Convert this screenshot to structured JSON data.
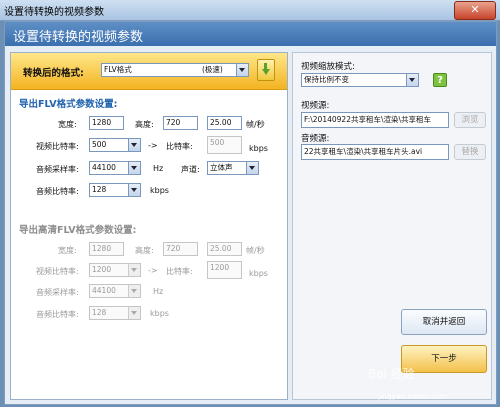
{
  "window": {
    "title": "设置待转换的视频参数"
  },
  "header": {
    "title": "设置待转换的视频参数"
  },
  "format": {
    "label": "转换后的格式:",
    "value": "FLV格式",
    "quality": "(极速)"
  },
  "flv": {
    "section_title": "导出FLV格式参数设置:",
    "width_label": "宽度:",
    "width_value": "1280",
    "height_label": "高度:",
    "height_value": "720",
    "fps_value": "25.00",
    "fps_unit": "帧/秒",
    "vbitrate_label": "视频比特率:",
    "vbitrate_value": "500",
    "arrow": "->",
    "bitrate_label": "比特率:",
    "bitrate_value": "500",
    "bitrate_unit": "kbps",
    "asample_label": "音频采样率:",
    "asample_value": "44100",
    "asample_unit": "Hz",
    "channel_label": "声道:",
    "channel_value": "立体声",
    "abitrate_label": "音频比特率:",
    "abitrate_value": "128",
    "abitrate_unit": "kbps"
  },
  "hdflv": {
    "section_title": "导出高清FLV格式参数设置:",
    "width_label": "宽度:",
    "width_value": "1280",
    "height_label": "高度:",
    "height_value": "720",
    "fps_value": "25.00",
    "fps_unit": "帧/秒",
    "vbitrate_label": "视频比特率:",
    "vbitrate_value": "1200",
    "arrow": "->",
    "bitrate_label": "比特率:",
    "bitrate_value": "1200",
    "bitrate_unit": "kbps",
    "asample_label": "音频采样率:",
    "asample_value": "44100",
    "asample_unit": "Hz",
    "abitrate_label": "音频比特率:",
    "abitrate_value": "128",
    "abitrate_unit": "kbps"
  },
  "right": {
    "scale_label": "视频缩放模式:",
    "scale_value": "保持比例不变",
    "help": "?",
    "video_src_label": "视频源:",
    "video_src_value": "F:\\20140922共享租车\\渲染\\共享租车",
    "audio_src_label": "音频源:",
    "audio_src_value": "22共享租车\\渲染\\共享租车片头.avi",
    "browse_label": "浏览",
    "replace_label": "替换"
  },
  "buttons": {
    "cancel_label": "取消并返回",
    "next_label": "下一步"
  },
  "watermark": {
    "brand": "Bai 经验",
    "url": "jingyan.baidu.com"
  },
  "colors": {
    "header": "#3b6fae",
    "format_bar": "#f4b321",
    "section": "#2264b0"
  }
}
